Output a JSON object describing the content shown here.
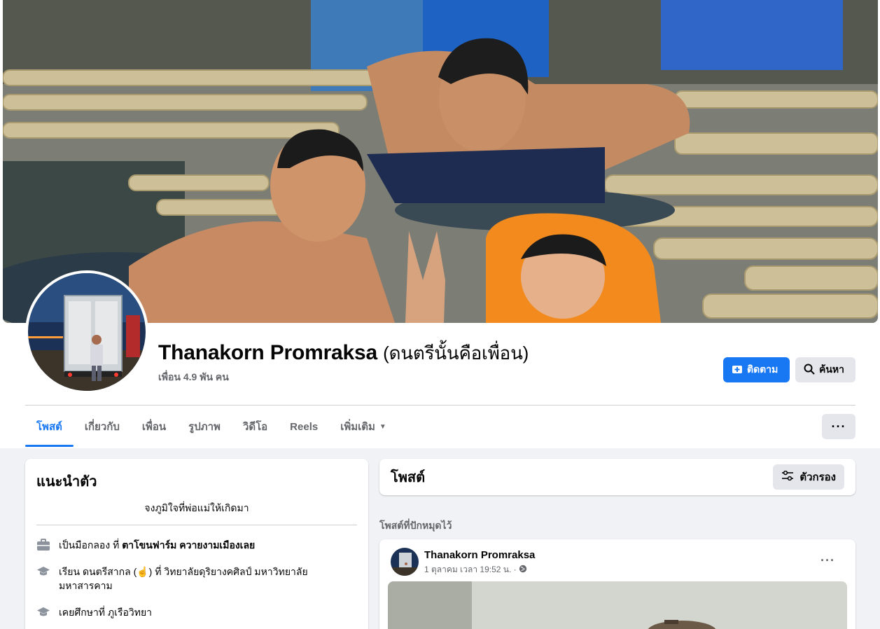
{
  "profile": {
    "name": "Thanakorn Promraksa",
    "alt_name": "(ดนตรีนั้นคือเพื่อน)",
    "friends": "เพื่อน 4.9 พัน คน"
  },
  "actions": {
    "follow_label": "ติดตาม",
    "search_label": "ค้นหา"
  },
  "tabs": [
    {
      "label": "โพสต์"
    },
    {
      "label": "เกี่ยวกับ"
    },
    {
      "label": "เพื่อน"
    },
    {
      "label": "รูปภาพ"
    },
    {
      "label": "วิดีโอ"
    },
    {
      "label": "Reels"
    },
    {
      "label": "เพิ่มเติม"
    }
  ],
  "intro": {
    "title": "แนะนำตัว",
    "bio": "จงภูมิใจที่พ่อแม่ให้เกิดมา",
    "work_prefix": "เป็นมือกลอง ที่ ",
    "work_place": "ตาโขนฟาร์ม ควายงามเมืองเลย",
    "study_text": "เรียน ดนตรีสากล (☝️) ที่ วิทยาลัยดุริยางคศิลป์ มหาวิทยาลัยมหาสารคาม",
    "school_text": "เคยศึกษาที่ ภูเรือวิทยา"
  },
  "posts": {
    "title": "โพสต์",
    "filter_label": "ตัวกรอง",
    "pinned_label": "โพสต์ที่ปักหมุดไว้"
  },
  "pinned_post": {
    "author": "Thanakorn Promraksa",
    "timestamp": "1 ตุลาคม เวลา 19:52 น. ·"
  },
  "colors": {
    "accent": "#1877f2",
    "secondary_button": "#e4e6eb",
    "page_bg": "#f0f2f5"
  },
  "icons": {
    "follow": "follow-plus-icon",
    "search": "search-icon",
    "more": "more-dots-icon",
    "dropdown": "caret-down-icon",
    "work": "briefcase-icon",
    "study": "graduation-cap-icon",
    "school": "graduation-cap-icon",
    "filter": "filter-sliders-icon",
    "privacy": "globe-icon"
  }
}
